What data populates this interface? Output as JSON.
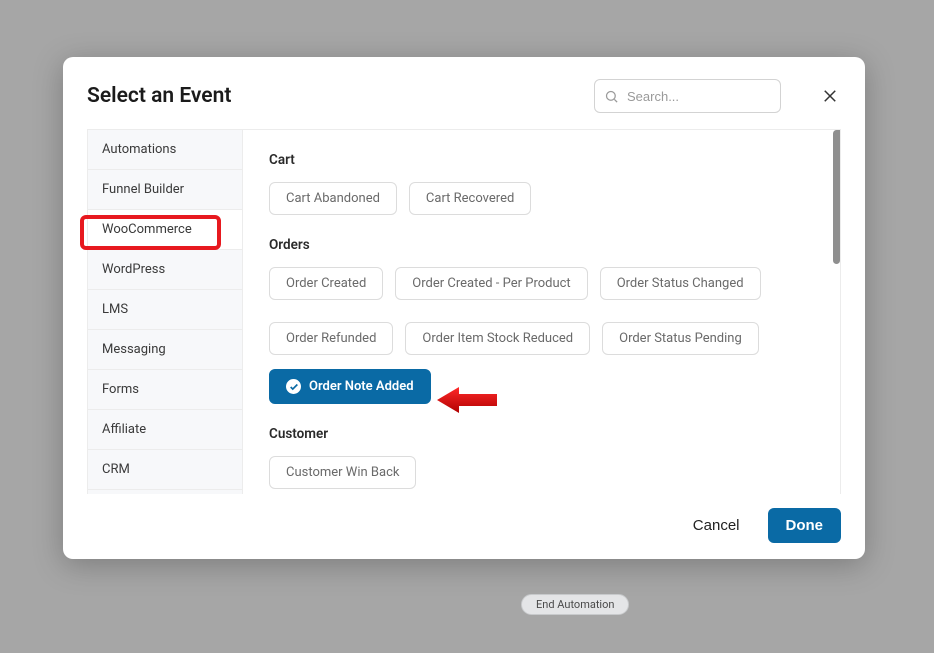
{
  "background_chip": "End Automation",
  "header": {
    "title": "Select an Event",
    "search_placeholder": "Search..."
  },
  "sidebar": {
    "items": [
      {
        "label": "Automations"
      },
      {
        "label": "Funnel Builder"
      },
      {
        "label": "WooCommerce"
      },
      {
        "label": "WordPress"
      },
      {
        "label": "LMS"
      },
      {
        "label": "Messaging"
      },
      {
        "label": "Forms"
      },
      {
        "label": "Affiliate"
      },
      {
        "label": "CRM"
      }
    ],
    "active_index": 2
  },
  "panel": {
    "sections": [
      {
        "title": "Cart",
        "events": [
          {
            "label": "Cart Abandoned",
            "selected": false
          },
          {
            "label": "Cart Recovered",
            "selected": false
          }
        ]
      },
      {
        "title": "Orders",
        "events": [
          {
            "label": "Order Created",
            "selected": false
          },
          {
            "label": "Order Created - Per Product",
            "selected": false
          },
          {
            "label": "Order Status Changed",
            "selected": false
          },
          {
            "label": "Order Refunded",
            "selected": false
          },
          {
            "label": "Order Item Stock Reduced",
            "selected": false
          },
          {
            "label": "Order Status Pending",
            "selected": false
          },
          {
            "label": "Order Note Added",
            "selected": true
          }
        ]
      },
      {
        "title": "Customer",
        "events": [
          {
            "label": "Customer Win Back",
            "selected": false
          }
        ]
      }
    ]
  },
  "footer": {
    "cancel": "Cancel",
    "done": "Done"
  },
  "annotations": {
    "highlight_sidebar_index": 2,
    "arrow_points_to": "Order Note Added"
  },
  "colors": {
    "primary": "#0a6aa5",
    "highlight": "#e7191f"
  }
}
